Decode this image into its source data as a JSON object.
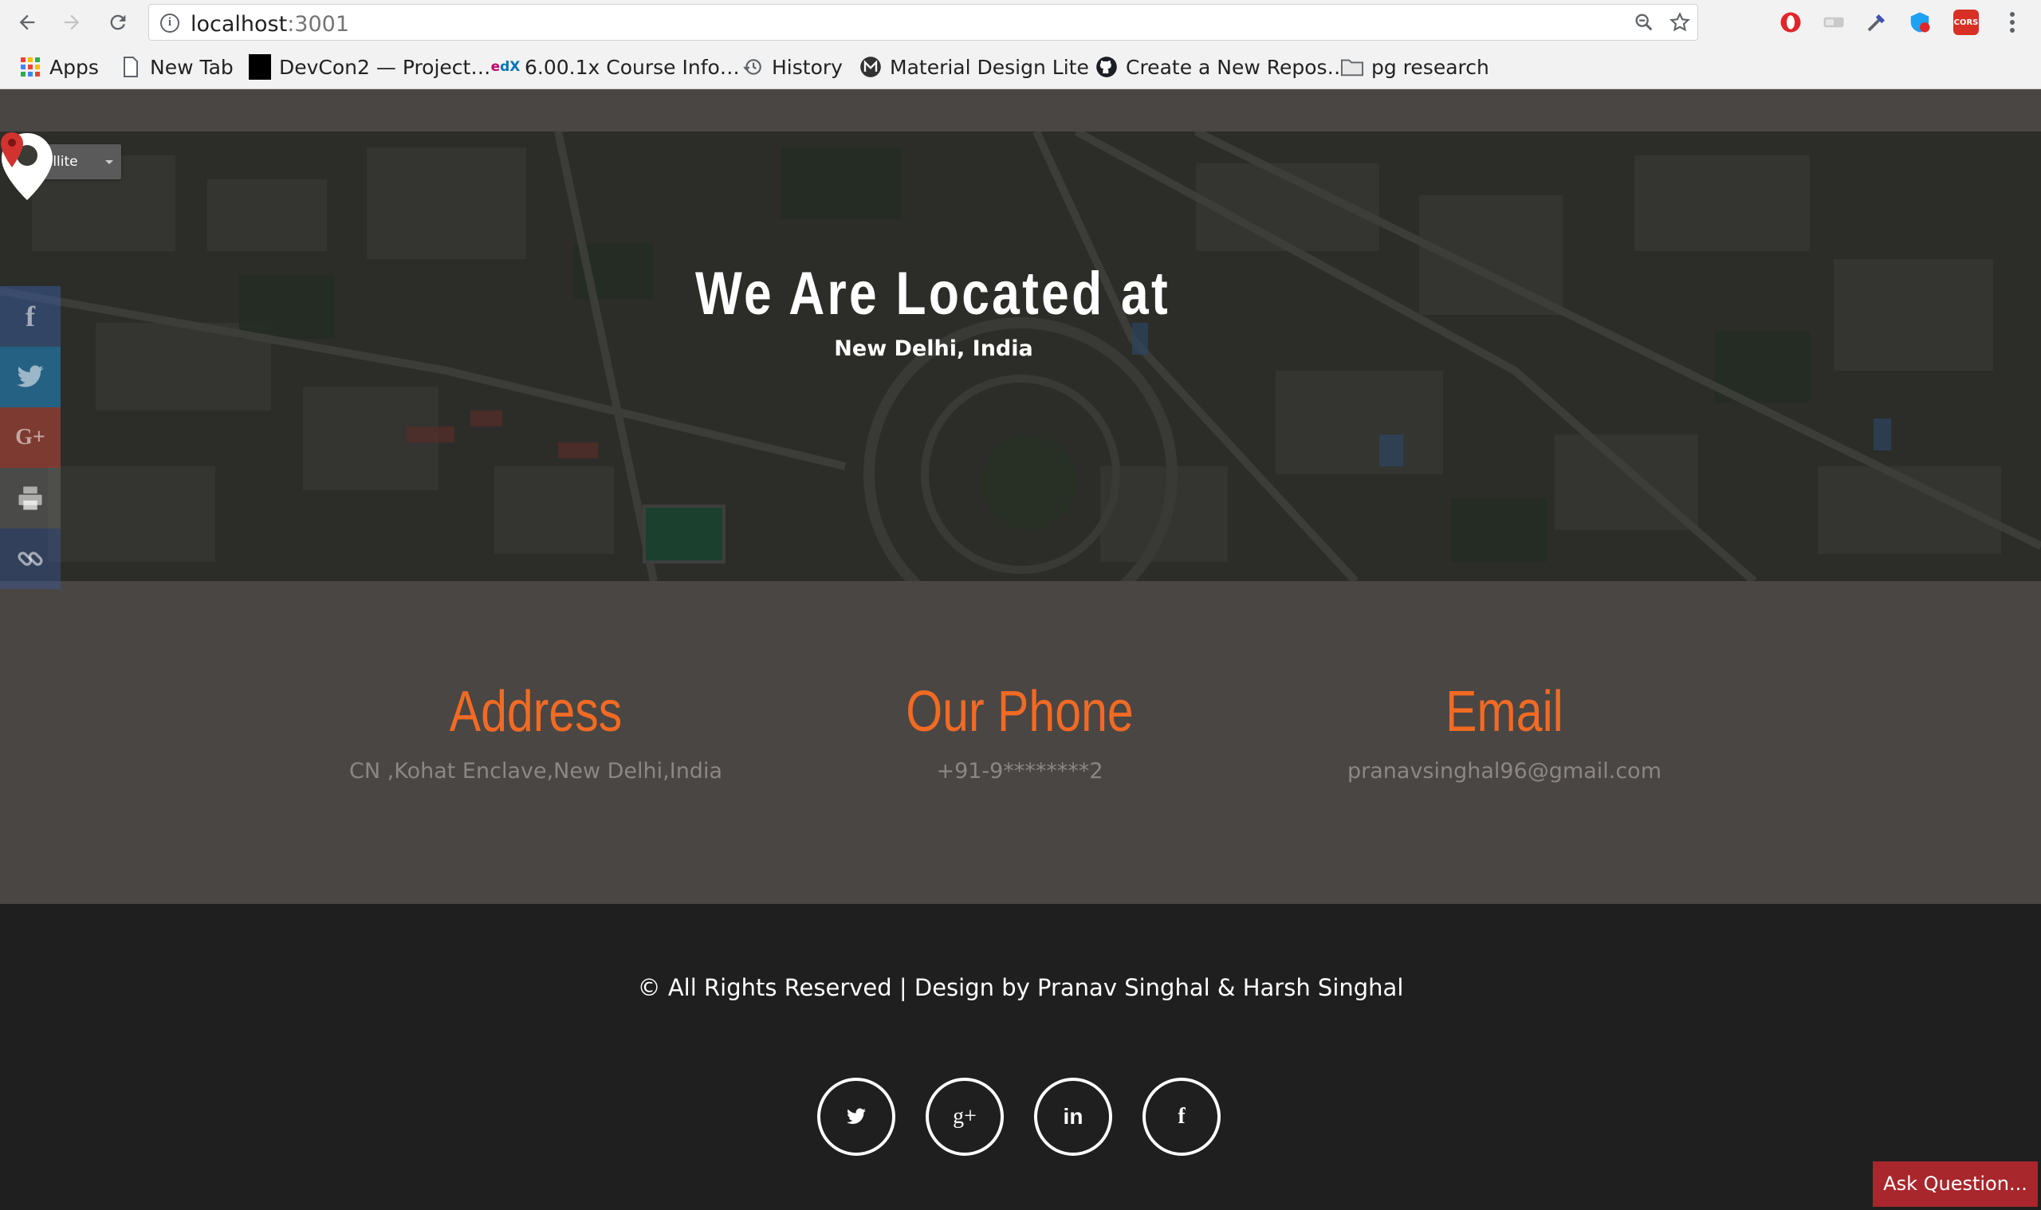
{
  "browser": {
    "url_host": "localhost",
    "url_port": ":3001",
    "bookmarks": [
      {
        "label": "Apps",
        "icon": "apps-grid-icon"
      },
      {
        "label": "New Tab",
        "icon": "page-icon"
      },
      {
        "label": "DevCon2 — Project…",
        "icon": "devcon-icon"
      },
      {
        "label": "6.00.1x Course Info…",
        "icon": "edx-icon"
      },
      {
        "label": "History",
        "icon": "history-icon"
      },
      {
        "label": "Material Design Lite",
        "icon": "mdl-icon"
      },
      {
        "label": "Create a New Repos…",
        "icon": "github-icon"
      },
      {
        "label": "pg research",
        "icon": "folder-icon"
      }
    ],
    "extension_cors_label": "CORS"
  },
  "map": {
    "type_selector": "Satellite",
    "title": "We Are Located at",
    "subtitle": "New Delhi, India"
  },
  "contact": {
    "address": {
      "heading": "Address",
      "value": "CN ,Kohat Enclave,New Delhi,India"
    },
    "phone": {
      "heading": "Our Phone",
      "value": "+91-9********2"
    },
    "email": {
      "heading": "Email",
      "value": "pranavsinghal96@gmail.com"
    }
  },
  "footer": {
    "copyright": "© All Rights Reserved | Design by Pranav Singhal & Harsh Singhal"
  },
  "ask_button": "Ask Question...",
  "colors": {
    "accent": "#f26a23",
    "section_bg": "#4a4644",
    "footer_bg": "#1f1f1f",
    "ask_bg": "#a8272c",
    "facebook": "#3b5998",
    "twitter": "#1da1f2",
    "google_plus": "#dd4b39"
  }
}
